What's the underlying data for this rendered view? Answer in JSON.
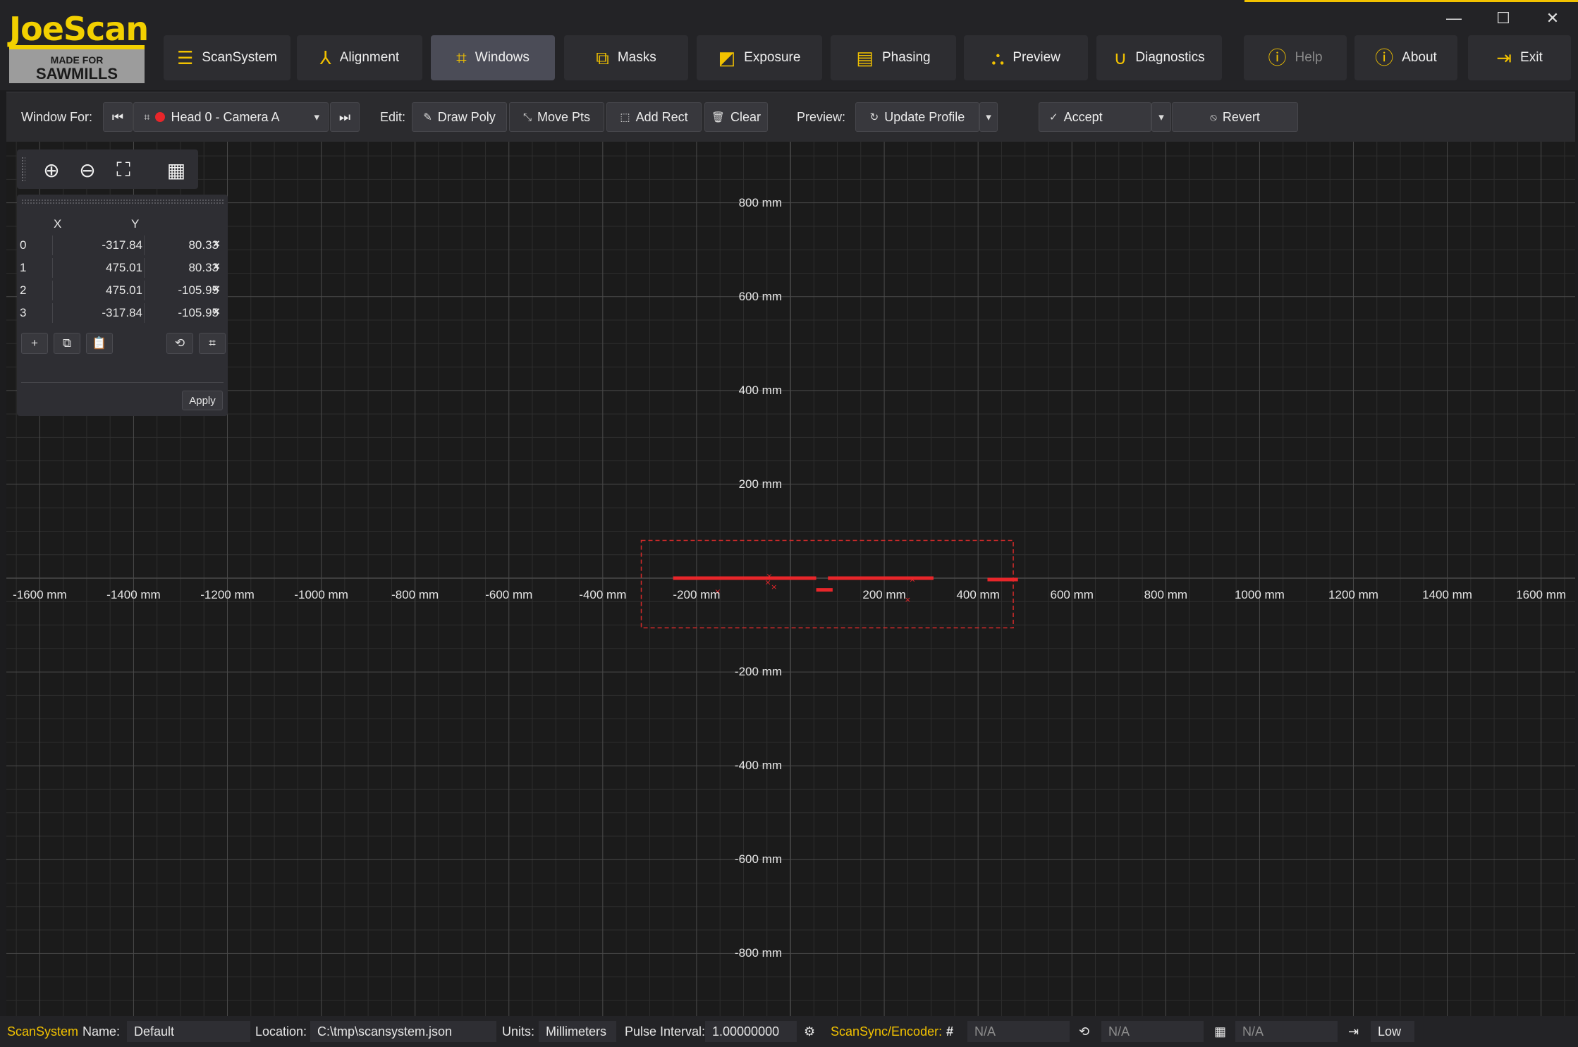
{
  "logo": {
    "brand": "JoeScan",
    "tag_top": "MADE FOR",
    "tag_bottom": "SAWMILLS"
  },
  "nav": [
    {
      "id": "scansystem",
      "label": "ScanSystem",
      "icon": "list-icon",
      "state": "normal"
    },
    {
      "id": "alignment",
      "label": "Alignment",
      "icon": "axes-icon",
      "state": "normal"
    },
    {
      "id": "windows",
      "label": "Windows",
      "icon": "window-frame-icon",
      "state": "active"
    },
    {
      "id": "masks",
      "label": "Masks",
      "icon": "masks-icon",
      "state": "normal"
    },
    {
      "id": "exposure",
      "label": "Exposure",
      "icon": "exposure-icon",
      "state": "normal"
    },
    {
      "id": "phasing",
      "label": "Phasing",
      "icon": "phasing-icon",
      "state": "normal"
    },
    {
      "id": "preview",
      "label": "Preview",
      "icon": "preview-icon",
      "state": "normal"
    },
    {
      "id": "diagnostics",
      "label": "Diagnostics",
      "icon": "stethoscope-icon",
      "state": "normal"
    },
    {
      "id": "help",
      "label": "Help",
      "icon": "help-icon",
      "state": "disabled"
    },
    {
      "id": "about",
      "label": "About",
      "icon": "info-icon",
      "state": "normal"
    },
    {
      "id": "exit",
      "label": "Exit",
      "icon": "exit-icon",
      "state": "normal"
    }
  ],
  "toolbar": {
    "window_for_label": "Window For:",
    "camera_selected": "Head 0 - Camera A",
    "edit_label": "Edit:",
    "draw_poly": "Draw Poly",
    "move_pts": "Move Pts",
    "add_rect": "Add Rect",
    "clear": "Clear",
    "preview_label": "Preview:",
    "update_profile": "Update Profile",
    "accept": "Accept",
    "revert": "Revert"
  },
  "points_panel": {
    "col_x": "X",
    "col_y": "Y",
    "points": [
      {
        "index": "0",
        "x": "-317.84",
        "y": "80.33"
      },
      {
        "index": "1",
        "x": "475.01",
        "y": "80.33"
      },
      {
        "index": "2",
        "x": "475.01",
        "y": "-105.95"
      },
      {
        "index": "3",
        "x": "-317.84",
        "y": "-105.95"
      }
    ],
    "apply": "Apply"
  },
  "plot": {
    "x_ticks": [
      {
        "v": -1600,
        "label": "-1600 mm"
      },
      {
        "v": -1400,
        "label": "-1400 mm"
      },
      {
        "v": -1200,
        "label": "-1200 mm"
      },
      {
        "v": -1000,
        "label": "-1000 mm"
      },
      {
        "v": -800,
        "label": "-800 mm"
      },
      {
        "v": -600,
        "label": "-600 mm"
      },
      {
        "v": -400,
        "label": "-400 mm"
      },
      {
        "v": -200,
        "label": "-200 mm"
      },
      {
        "v": 200,
        "label": "200 mm"
      },
      {
        "v": 400,
        "label": "400 mm"
      },
      {
        "v": 600,
        "label": "600 mm"
      },
      {
        "v": 800,
        "label": "800 mm"
      },
      {
        "v": 1000,
        "label": "1000 mm"
      },
      {
        "v": 1200,
        "label": "1200 mm"
      },
      {
        "v": 1400,
        "label": "1400 mm"
      },
      {
        "v": 1600,
        "label": "1600 mm"
      }
    ],
    "y_ticks": [
      {
        "v": 800,
        "label": "800 mm"
      },
      {
        "v": 600,
        "label": "600 mm"
      },
      {
        "v": 400,
        "label": "400 mm"
      },
      {
        "v": 200,
        "label": "200 mm"
      },
      {
        "v": -200,
        "label": "-200 mm"
      },
      {
        "v": -400,
        "label": "-400 mm"
      },
      {
        "v": -600,
        "label": "-600 mm"
      },
      {
        "v": -800,
        "label": "-800 mm"
      }
    ],
    "window_polygon": [
      {
        "x": -317.84,
        "y": 80.33
      },
      {
        "x": 475.01,
        "y": 80.33
      },
      {
        "x": 475.01,
        "y": -105.95
      },
      {
        "x": -317.84,
        "y": -105.95
      }
    ],
    "profile_segments": [
      {
        "x1": -250,
        "x2": 55,
        "y": 0
      },
      {
        "x1": 80,
        "x2": 305,
        "y": 0
      },
      {
        "x1": 420,
        "x2": 485,
        "y": -3
      },
      {
        "x1": 55,
        "x2": 90,
        "y": -25
      }
    ],
    "profile_markers": [
      {
        "x": -155,
        "y": -28
      },
      {
        "x": -45,
        "y": 5
      },
      {
        "x": -35,
        "y": -18
      },
      {
        "x": -48,
        "y": -8
      },
      {
        "x": 260,
        "y": -2
      },
      {
        "x": 250,
        "y": -45
      }
    ],
    "colors": {
      "profile": "#e8262a",
      "window": "#d42a2a",
      "grid_major": "#4a4a4a",
      "grid_minor": "#2e2e2e"
    }
  },
  "status": {
    "scansystem": "ScanSystem",
    "name_label": "Name:",
    "name_value": "Default",
    "location_label": "Location:",
    "location_value": "C:\\tmp\\scansystem.json",
    "units_label": "Units:",
    "units_value": "Millimeters",
    "pulse_label": "Pulse Interval:",
    "pulse_value": "1.00000000",
    "scansync_label": "ScanSync/Encoder:",
    "field1": "N/A",
    "field2": "N/A",
    "field3": "N/A",
    "level": "Low"
  }
}
